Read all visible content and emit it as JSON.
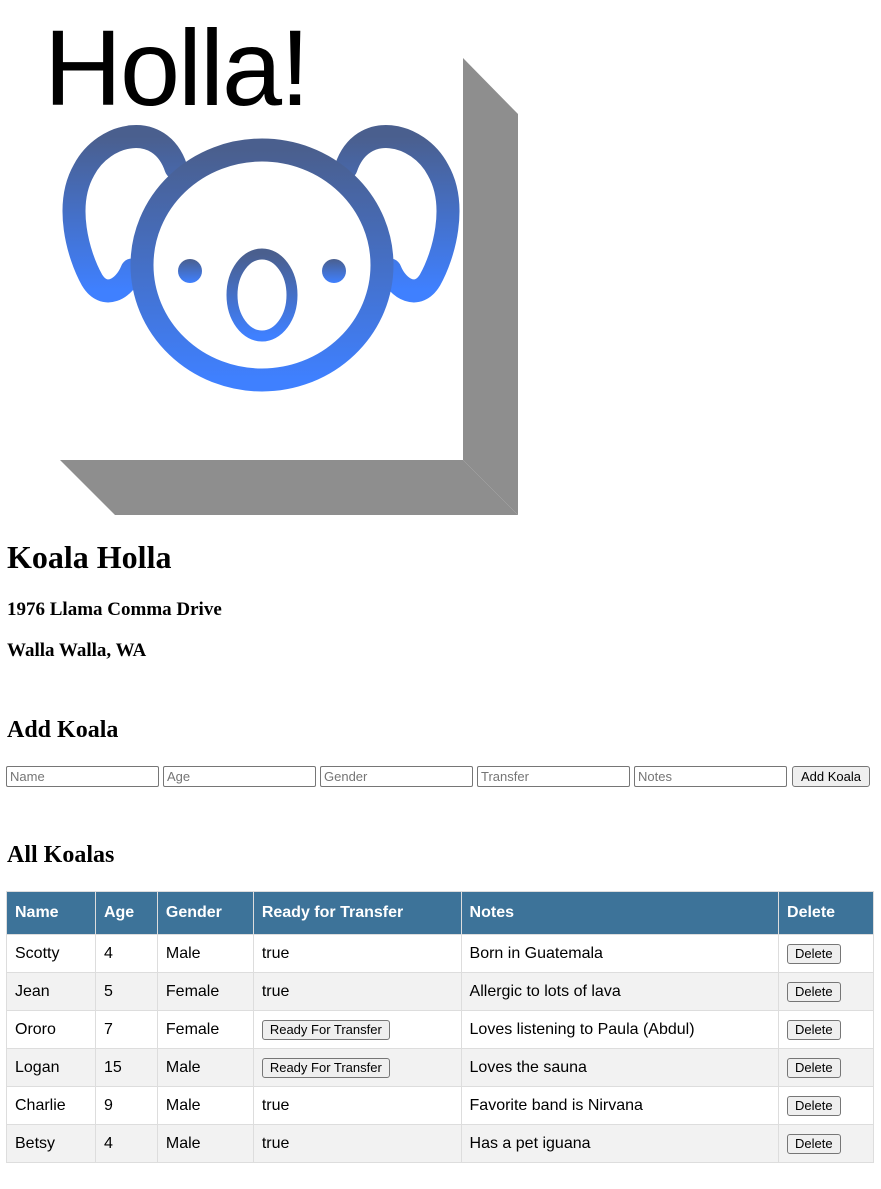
{
  "logo": {
    "title": "Holla!",
    "icon": "koala-face-icon",
    "gradient_top": "#4a5f8e",
    "gradient_bottom": "#3f80ff",
    "shadow_color": "#8e8e8e"
  },
  "site": {
    "title": "Koala Holla",
    "address_line1": "1976 Llama Comma Drive",
    "address_line2": "Walla Walla, WA"
  },
  "add_form": {
    "heading": "Add Koala",
    "name_placeholder": "Name",
    "age_placeholder": "Age",
    "gender_placeholder": "Gender",
    "transfer_placeholder": "Transfer",
    "notes_placeholder": "Notes",
    "submit_label": "Add Koala"
  },
  "table": {
    "heading": "All Koalas",
    "header_color": "#3d7399",
    "columns": [
      "Name",
      "Age",
      "Gender",
      "Ready for Transfer",
      "Notes",
      "Delete"
    ],
    "transfer_button_label": "Ready For Transfer",
    "delete_button_label": "Delete",
    "rows": [
      {
        "name": "Scotty",
        "age": "4",
        "gender": "Male",
        "transfer": "true",
        "notes": "Born in Guatemala"
      },
      {
        "name": "Jean",
        "age": "5",
        "gender": "Female",
        "transfer": "true",
        "notes": "Allergic to lots of lava"
      },
      {
        "name": "Ororo",
        "age": "7",
        "gender": "Female",
        "transfer": "button",
        "notes": "Loves listening to Paula (Abdul)"
      },
      {
        "name": "Logan",
        "age": "15",
        "gender": "Male",
        "transfer": "button",
        "notes": "Loves the sauna"
      },
      {
        "name": "Charlie",
        "age": "9",
        "gender": "Male",
        "transfer": "true",
        "notes": "Favorite band is Nirvana"
      },
      {
        "name": "Betsy",
        "age": "4",
        "gender": "Male",
        "transfer": "true",
        "notes": "Has a pet iguana"
      }
    ]
  }
}
